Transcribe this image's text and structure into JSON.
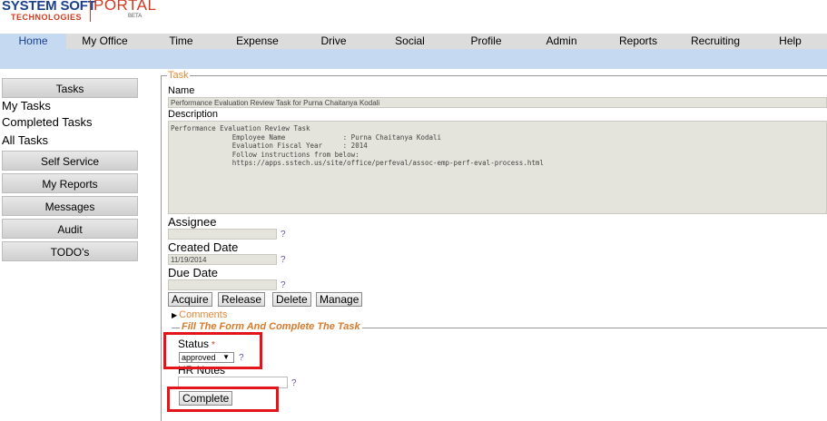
{
  "logo": {
    "line1": "SYSTEM SOFT",
    "line2": "TECHNOLOGIES",
    "portal": "PORTAL",
    "beta": "BETA"
  },
  "nav": {
    "items": [
      "Home",
      "My Office",
      "Time",
      "Expense",
      "Drive",
      "Social",
      "Profile",
      "Admin",
      "Reports",
      "Recruiting",
      "Help"
    ],
    "active": "Home"
  },
  "sidebar": {
    "tasks_button": "Tasks",
    "links": [
      "My Tasks",
      "Completed Tasks",
      "All Tasks"
    ],
    "buttons": [
      "Self Service",
      "My Reports",
      "Messages",
      "Audit",
      "TODO's"
    ]
  },
  "task": {
    "legend": "Task",
    "name_label": "Name",
    "name_value": "Performance Evaluation Review Task for Purna Chaitanya Kodali",
    "description_label": "Description",
    "description_value": "Performance Evaluation Review Task\n               Employee Name              : Purna Chaitanya Kodali\n               Evaluation Fiscal Year     : 2014\n               Follow instructions from below:\n               https://apps.sstech.us/site/office/perfeval/assoc-emp-perf-eval-process.html",
    "assignee_label": "Assignee",
    "assignee_value": "",
    "created_label": "Created Date",
    "created_value": "11/19/2014",
    "due_label": "Due Date",
    "due_value": "",
    "help_mark": "?",
    "buttons": {
      "acquire": "Acquire",
      "release": "Release",
      "delete": "Delete",
      "manage": "Manage"
    },
    "comments_label": "Comments",
    "comments_icon": "triangle-right-icon"
  },
  "complete_form": {
    "legend": "Fill The Form And Complete The Task",
    "status_label": "Status",
    "required_mark": "*",
    "status_selected": "approved",
    "select_arrow": "▼",
    "hr_notes_label": "HR Notes",
    "hr_notes_value": "",
    "complete_button": "Complete"
  },
  "colors": {
    "highlight_box": "#e3141a",
    "accent_orange": "#e08a3a",
    "nav_active": "#c5daf0"
  }
}
